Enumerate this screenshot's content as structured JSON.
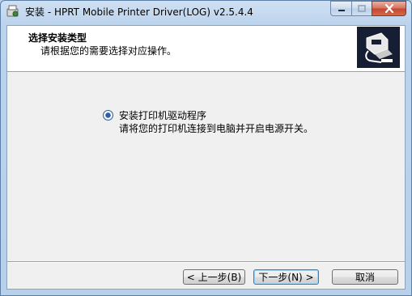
{
  "window": {
    "title": "安装 - HPRT Mobile Printer Driver(LOG) v2.5.4.4"
  },
  "header": {
    "title": "选择安装类型",
    "subtitle": "请根据您的需要选择对应操作。"
  },
  "option": {
    "label": "安装打印机驱动程序",
    "description": "请将您的打印机连接到电脑并开启电源开关。",
    "selected": true
  },
  "buttons": {
    "back": "< 上一步(B)",
    "next": "下一步(N) >",
    "cancel": "取消"
  }
}
